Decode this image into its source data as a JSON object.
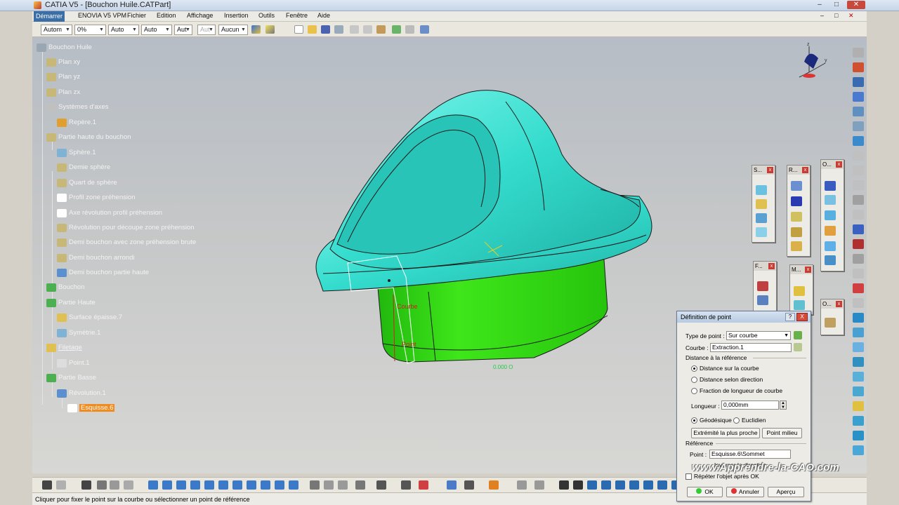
{
  "window": {
    "title": "CATIA V5 - [Bouchon Huile.CATPart]",
    "min": "–",
    "max": "□",
    "close": "✕",
    "inner_min": "–",
    "inner_max": "□",
    "inner_close": "✕"
  },
  "menu": [
    "Démarrer",
    "ENOVIA V5 VPM",
    "Fichier",
    "Edition",
    "Affichage",
    "Insertion",
    "Outils",
    "Fenêtre",
    "Aide"
  ],
  "toolbar": {
    "combos": [
      "Autom",
      "0%",
      "Auto",
      "Auto",
      "Aut",
      "Aut",
      "Aucun"
    ]
  },
  "tree": [
    {
      "label": "Bouchon Huile",
      "icon": "part-icon",
      "color": "#9aa6b2"
    },
    {
      "label": "Plan xy",
      "icon": "plane-icon",
      "color": "#c8b878"
    },
    {
      "label": "Plan yz",
      "icon": "plane-icon",
      "color": "#c8b878"
    },
    {
      "label": "Plan zx",
      "icon": "plane-icon",
      "color": "#c8b878"
    },
    {
      "label": "Systèmes d'axes",
      "icon": "axis-folder-icon",
      "color": "#c0c0c0"
    },
    {
      "label": "Repère.1",
      "icon": "axis-system-icon",
      "color": "#e0a030"
    },
    {
      "label": "Partie haute du bouchon",
      "icon": "geometrical-set-icon",
      "color": "#c8b878"
    },
    {
      "label": "Sphère.1",
      "icon": "sphere-icon",
      "color": "#7fb3d5"
    },
    {
      "label": "Demie sphère",
      "icon": "surface-icon",
      "color": "#c8b878"
    },
    {
      "label": "Quart de sphère",
      "icon": "surface-icon",
      "color": "#c8b878"
    },
    {
      "label": "Profil zone préhension",
      "icon": "sketch-icon",
      "color": "#ffffff"
    },
    {
      "label": "Axe révolution profil préhension",
      "icon": "line-icon",
      "color": "#ffffff"
    },
    {
      "label": "Révolution pour découpe zone préhension",
      "icon": "surface-icon",
      "color": "#c8b878"
    },
    {
      "label": "Demi bouchon avec zone préhension brute",
      "icon": "surface-icon",
      "color": "#c8b878"
    },
    {
      "label": "Demi bouchon arrondi",
      "icon": "surface-icon",
      "color": "#c8b878"
    },
    {
      "label": "Demi bouchon partie haute",
      "icon": "surface-icon",
      "color": "#5a8fd0"
    },
    {
      "label": "Bouchon",
      "icon": "body-icon",
      "color": "#4caf50"
    },
    {
      "label": "Partie Haute",
      "icon": "body-icon",
      "color": "#4caf50"
    },
    {
      "label": "Surface épaisse.7",
      "icon": "thick-surface-icon",
      "color": "#e0c050"
    },
    {
      "label": "Symétrie.1",
      "icon": "symmetry-icon",
      "color": "#7fb3d5"
    },
    {
      "label": "Filetage",
      "icon": "geometrical-set-icon",
      "color": "#e0c050"
    },
    {
      "label": "Point.1",
      "icon": "point-icon",
      "color": "#dddddd"
    },
    {
      "label": "Partie Basse",
      "icon": "body-icon",
      "color": "#4caf50"
    },
    {
      "label": "Révolution.1",
      "icon": "revolution-icon",
      "color": "#5a8fd0"
    },
    {
      "label": "Esquisse.6",
      "icon": "sketch-icon",
      "color": "#ffffff"
    }
  ],
  "scene": {
    "label_curve": "Courbe",
    "label_point": "Point",
    "dim_text": "0.000 O",
    "colors": {
      "cap_top": "#34dccd",
      "cap_bottom": "#33dd11"
    }
  },
  "compass": {
    "z": "z",
    "y": "y"
  },
  "palettes": [
    {
      "title": "S..."
    },
    {
      "title": "R..."
    },
    {
      "title": "O..."
    },
    {
      "title": "F..."
    },
    {
      "title": "M..."
    },
    {
      "title": "O..."
    }
  ],
  "dialog": {
    "title": "Définition de point",
    "help": "?",
    "close": "X",
    "type_label": "Type de point :",
    "type_value": "Sur courbe",
    "curve_label": "Courbe :",
    "curve_value": "Extraction.1",
    "distance_group": "Distance à la référence",
    "options": [
      "Distance sur la courbe",
      "Distance selon direction",
      "Fraction de longueur de courbe"
    ],
    "length_label": "Longueur :",
    "length_value": "0,000mm",
    "geodesic": "Géodésique",
    "euclidean": "Euclidien",
    "btn_far": "Extrémité la plus proche",
    "btn_mid": "Point milieu",
    "reference_group": "Référence",
    "point_label": "Point :",
    "point_value": "Esquisse.6\\Sommet",
    "invert": "Inverser la direction",
    "repeat": "Répéter l'objet après OK",
    "ok": "OK",
    "cancel": "Annuler",
    "preview": "Aperçu"
  },
  "status": "Cliquer pour fixer le point sur la courbe ou sélectionner un point de référence",
  "watermark": "www.Apprendre-la-CAO.com"
}
